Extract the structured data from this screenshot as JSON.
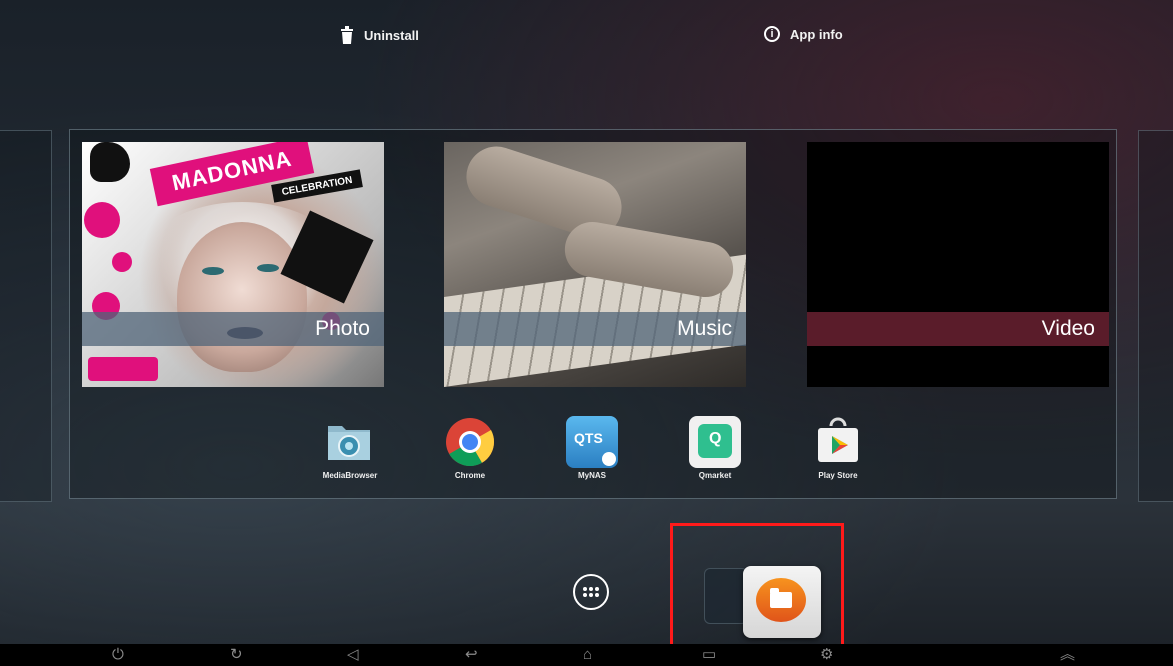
{
  "drop_targets": {
    "uninstall_label": "Uninstall",
    "app_info_label": "App info"
  },
  "tiles": [
    {
      "label": "Photo",
      "cover_title": "MADONNA",
      "cover_subtitle": "CELEBRATION"
    },
    {
      "label": "Music"
    },
    {
      "label": "Video"
    }
  ],
  "apps": [
    {
      "label": "MediaBrowser",
      "icon": "media-browser-icon"
    },
    {
      "label": "Chrome",
      "icon": "chrome-icon"
    },
    {
      "label": "MyNAS",
      "icon": "mynas-icon",
      "icon_text": "QTS"
    },
    {
      "label": "Qmarket",
      "icon": "qmarket-icon",
      "icon_text": "Q"
    },
    {
      "label": "Play Store",
      "icon": "play-store-icon"
    }
  ],
  "hotseat": {
    "all_apps_icon": "all-apps-icon",
    "dragged_app_icon": "file-manager-icon"
  },
  "navbar": {
    "power": "⏻",
    "rotate": "↻",
    "volume": "◁",
    "back": "↩",
    "home": "⌂",
    "recents": "▭",
    "settings": "⚙",
    "expand": "︽"
  },
  "colors": {
    "highlight": "#ff1a1a",
    "video_label_bg": "#5a1c2a",
    "photo_accent": "#e0107c"
  }
}
